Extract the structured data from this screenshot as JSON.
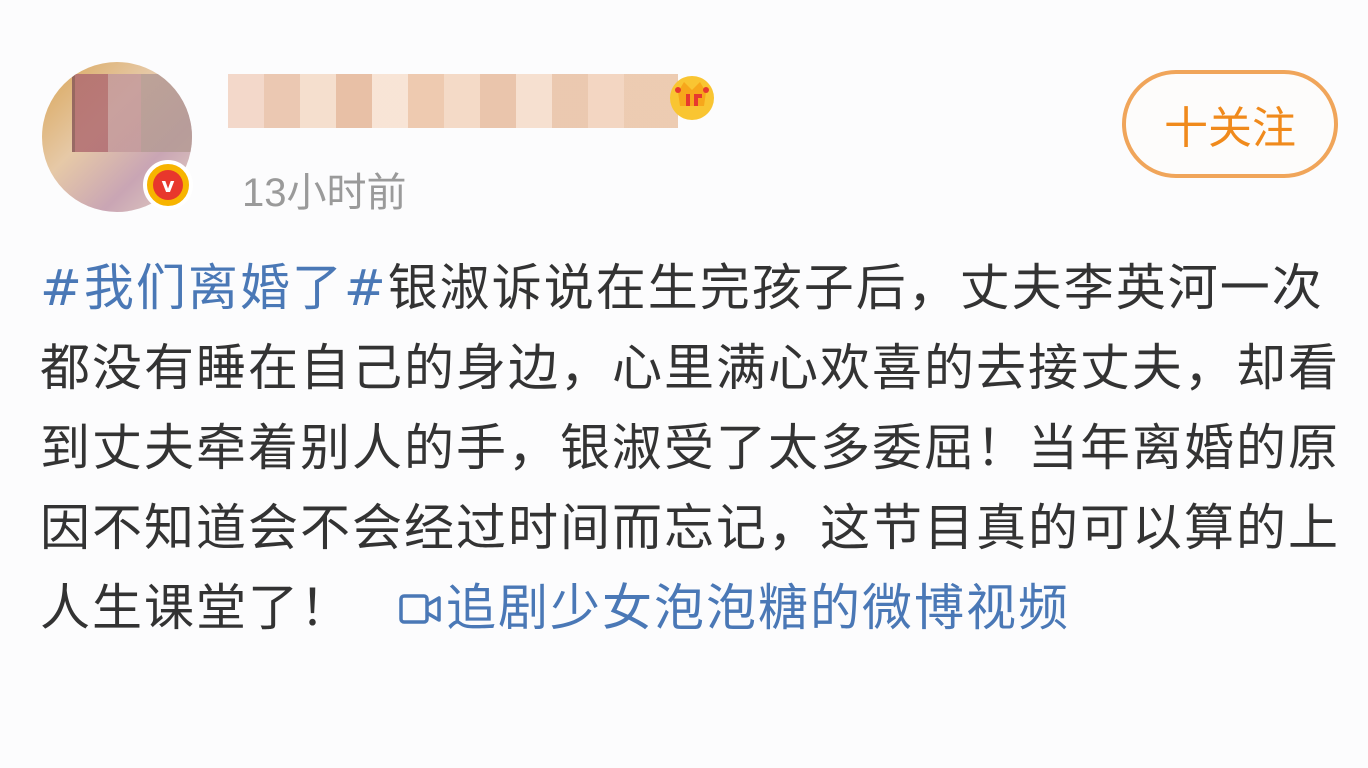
{
  "header": {
    "username": "",
    "timestamp": "13小时前",
    "follow_label": "十关注"
  },
  "post": {
    "topic": "#我们离婚了#",
    "text": "银淑诉说在生完孩子后，丈夫李英河一次都没有睡在自己的身边，心里满心欢喜的去接丈夫，却看到丈夫牵着别人的手，银淑受了太多委屈！当年离婚的原因不知道会不会经过时间而忘记，这节目真的可以算的上人生课堂了！",
    "video_link": "追剧少女泡泡糖的微博视频"
  },
  "icons": {
    "verified": "verified-v-icon",
    "crown": "vip-crown-icon",
    "video": "video-camera-icon"
  },
  "colors": {
    "link": "#4a78b6",
    "follow": "#f08a1c",
    "text": "#333333",
    "timestamp": "#9a9a9a"
  }
}
